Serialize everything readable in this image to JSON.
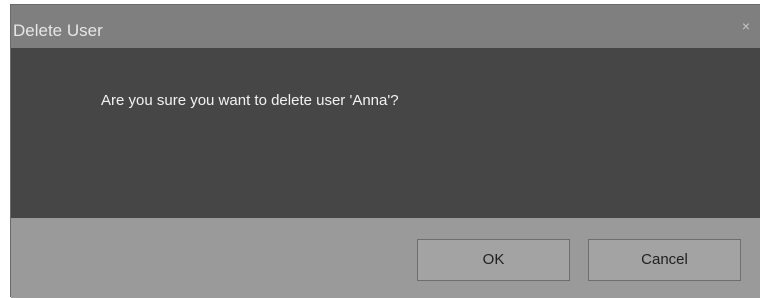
{
  "dialog": {
    "title": "Delete User",
    "close_glyph": "×",
    "message": "Are you sure you want to delete user 'Anna'?",
    "buttons": {
      "ok_label": "OK",
      "cancel_label": "Cancel"
    }
  },
  "colors": {
    "titlebar": "#7f7f7f",
    "content": "#464646",
    "footer": "#9a9a9a",
    "button": "#a3a3a3"
  }
}
